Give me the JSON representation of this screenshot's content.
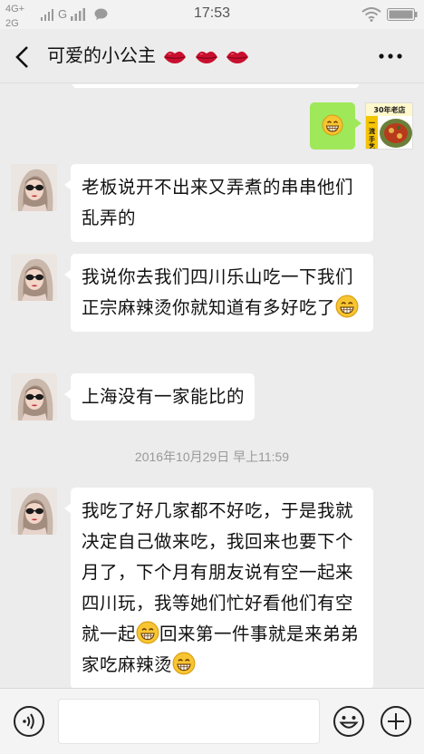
{
  "status_bar": {
    "network": "4G+",
    "network2": "2G",
    "carrier_mark": "G",
    "time": "17:53",
    "icons": [
      "signal-bars-icon",
      "message-icon",
      "wifi-icon",
      "battery-icon"
    ]
  },
  "nav": {
    "title": "可爱的小公主",
    "title_icons": [
      "lips-icon",
      "lips-icon",
      "lips-icon"
    ],
    "back_icon": "chevron-left-icon",
    "more_icon": "more-dots-icon"
  },
  "messages": [
    {
      "side": "right",
      "content_icon": "grin-emoji-icon",
      "avatar_caption": "30年老店 一流手艺"
    },
    {
      "side": "left",
      "text": "老板说开不出来又弄煮的串串他们乱弄的"
    },
    {
      "side": "left",
      "text": "我说你去我们四川乐山吃一下我们正宗麻辣烫你就知道有多好吃了",
      "trailing_icon": "grin-emoji-icon"
    },
    {
      "side": "left",
      "text": "上海没有一家能比的"
    },
    {
      "side": "left",
      "text_a": "我吃了好几家都不好吃，于是我就决定自己做来吃，我回来也要下个月了，下个月有朋友说有空一起来四川玩，我等她们忙好看他们有空就一起",
      "text_b": "回来第一件事就是来弟弟家吃麻辣烫",
      "icon": "grin-emoji-icon"
    }
  ],
  "timestamp": "2016年10月29日 早上11:59",
  "input_bar": {
    "value": "",
    "icons": [
      "voice-icon",
      "emoji-smile-icon",
      "plus-icon"
    ]
  },
  "colors": {
    "sent_bubble": "#9fe85a",
    "received_bubble": "#ffffff",
    "background": "#ececec",
    "lips": "#c8102e"
  }
}
